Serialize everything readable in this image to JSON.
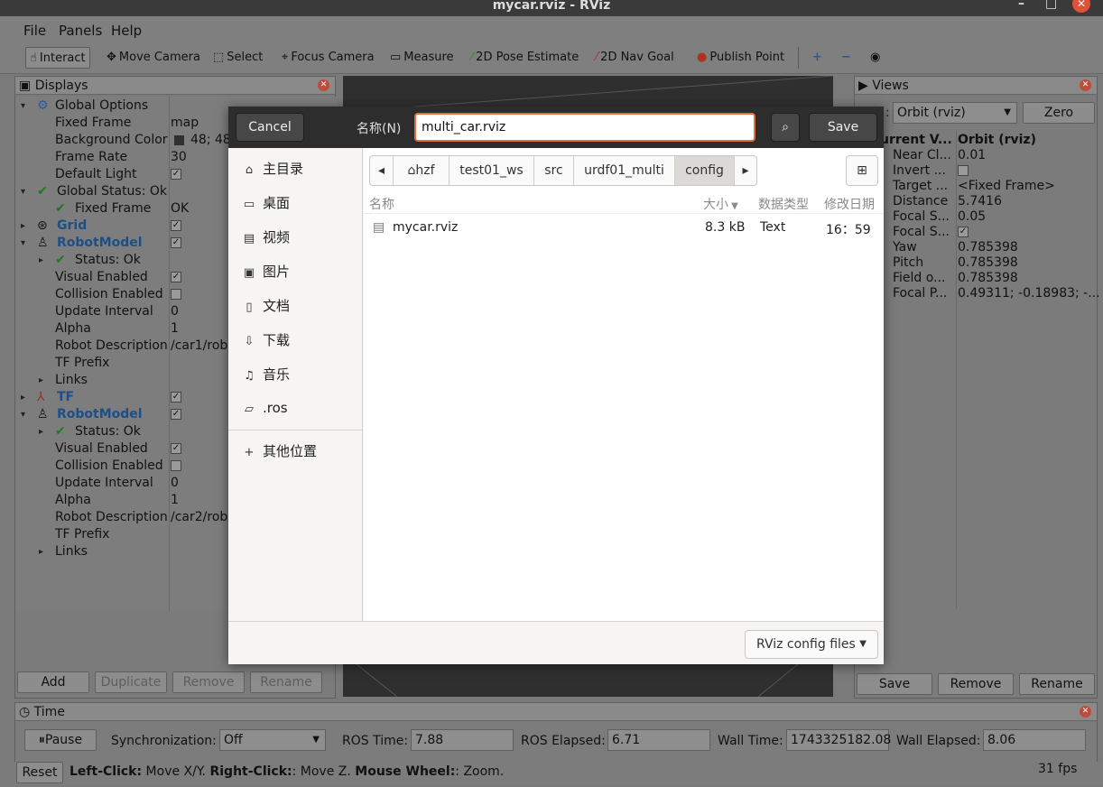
{
  "window": {
    "title": "mycar.rviz - RViz",
    "controls": [
      "–",
      "□",
      "✕"
    ]
  },
  "menu": [
    "File",
    "Panels",
    "Help"
  ],
  "toolbar": {
    "tools": [
      "Interact",
      "Move Camera",
      "Select",
      "Focus Camera",
      "Measure",
      "2D Pose Estimate",
      "2D Nav Goal",
      "Publish Point"
    ],
    "icons": [
      "+",
      "−",
      "◉"
    ]
  },
  "displays": {
    "title": "Displays",
    "rows": [
      {
        "label": "Global Options",
        "value": ""
      },
      {
        "label": "Fixed Frame",
        "value": "map"
      },
      {
        "label": "Background Color",
        "value": "48; 48;"
      },
      {
        "label": "Frame Rate",
        "value": "30"
      },
      {
        "label": "Default Light",
        "value": "✓"
      },
      {
        "label": "Global Status: Ok",
        "value": ""
      },
      {
        "label": "Fixed Frame",
        "value": "OK"
      },
      {
        "label": "Grid",
        "value": "✓"
      },
      {
        "label": "RobotModel",
        "value": "✓"
      },
      {
        "label": "Status: Ok",
        "value": ""
      },
      {
        "label": "Visual Enabled",
        "value": "✓"
      },
      {
        "label": "Collision Enabled",
        "value": ""
      },
      {
        "label": "Update Interval",
        "value": "0"
      },
      {
        "label": "Alpha",
        "value": "1"
      },
      {
        "label": "Robot Description",
        "value": "/car1/rob"
      },
      {
        "label": "TF Prefix",
        "value": ""
      },
      {
        "label": "Links",
        "value": ""
      },
      {
        "label": "TF",
        "value": "✓"
      },
      {
        "label": "RobotModel",
        "value": "✓"
      },
      {
        "label": "Status: Ok",
        "value": ""
      },
      {
        "label": "Visual Enabled",
        "value": "✓"
      },
      {
        "label": "Collision Enabled",
        "value": ""
      },
      {
        "label": "Update Interval",
        "value": "0"
      },
      {
        "label": "Alpha",
        "value": "1"
      },
      {
        "label": "Robot Description",
        "value": "/car2/rob"
      },
      {
        "label": "TF Prefix",
        "value": ""
      },
      {
        "label": "Links",
        "value": ""
      }
    ],
    "buttons": [
      "Add",
      "Duplicate",
      "Remove",
      "Rename"
    ]
  },
  "views": {
    "title": "Views",
    "type_prefix": ":",
    "type": "Orbit (rviz)",
    "zero": "Zero",
    "rows": [
      {
        "label": "urrent V...",
        "value": "Orbit (rviz)"
      },
      {
        "label": "Near Cl...",
        "value": "0.01"
      },
      {
        "label": "Invert ...",
        "value": ""
      },
      {
        "label": "Target ...",
        "value": "<Fixed Frame>"
      },
      {
        "label": "Distance",
        "value": "5.7416"
      },
      {
        "label": "Focal S...",
        "value": "0.05"
      },
      {
        "label": "Focal S...",
        "value": "✓"
      },
      {
        "label": "Yaw",
        "value": "0.785398"
      },
      {
        "label": "Pitch",
        "value": "0.785398"
      },
      {
        "label": "Field o...",
        "value": "0.785398"
      },
      {
        "label": "Focal P...",
        "value": "0.49311; -0.18983; -..."
      }
    ],
    "buttons": [
      "Save",
      "Remove",
      "Rename"
    ]
  },
  "time": {
    "title": "Time",
    "pause": "Pause",
    "sync_label": "Synchronization:",
    "sync_value": "Off",
    "ros_time_label": "ROS Time:",
    "ros_time": "7.88",
    "ros_elapsed_label": "ROS Elapsed:",
    "ros_elapsed": "6.71",
    "wall_time_label": "Wall Time:",
    "wall_time": "1743325182.08",
    "wall_elapsed_label": "Wall Elapsed:",
    "wall_elapsed": "8.06"
  },
  "status": {
    "reset": "Reset",
    "left_b": "Left-Click:",
    "left": " Move X/Y. ",
    "right_b": "Right-Click:",
    "right": ": Move Z. ",
    "wheel_b": "Mouse Wheel:",
    "wheel": ": Zoom.",
    "fps": "31 fps"
  },
  "dialog": {
    "cancel": "Cancel",
    "name_label": "名称(N)",
    "filename": "multi_car.rviz",
    "save": "Save",
    "places": [
      "主目录",
      "桌面",
      "视频",
      "图片",
      "文档",
      "下载",
      "音乐",
      ".ros"
    ],
    "other_locations": "其他位置",
    "path": [
      "hzf",
      "test01_ws",
      "src",
      "urdf01_multi",
      "config"
    ],
    "columns": {
      "name": "名称",
      "size": "大小",
      "type": "数据类型",
      "modified": "修改日期"
    },
    "files": [
      {
        "name": "mycar.rviz",
        "size": "8.3 kB",
        "type": "Text",
        "modified": "16：59"
      }
    ],
    "filter": "RViz config files"
  }
}
